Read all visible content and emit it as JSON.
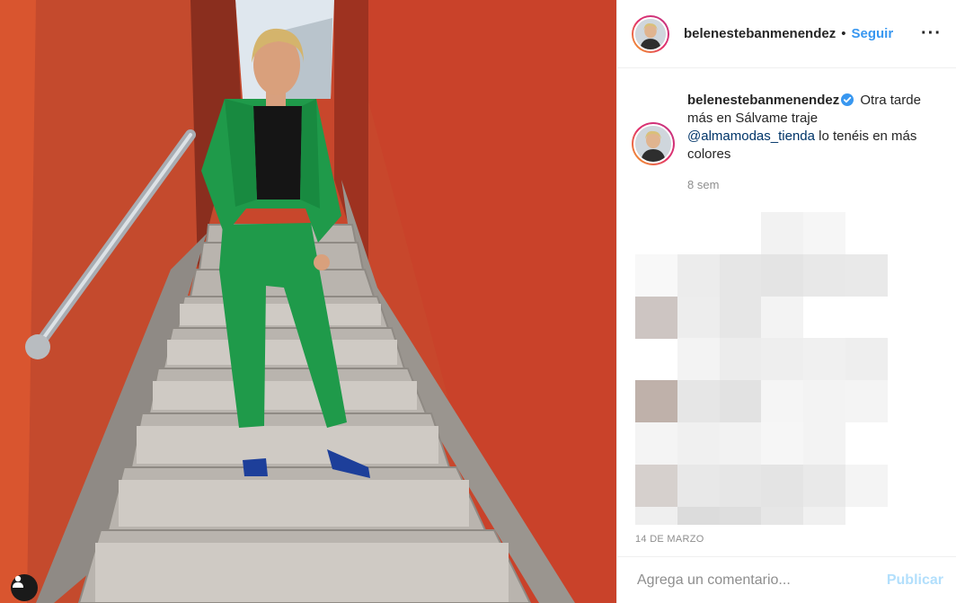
{
  "post": {
    "username": "belenestebanmenendez",
    "separator": "•",
    "follow_label": "Seguir",
    "more_label": "···"
  },
  "caption": {
    "username": "belenestebanmenendez",
    "text_1": "Otra tarde más en Sálvame traje",
    "mention": "@almamodas_tienda",
    "text_2": "lo tenéis en más colores",
    "time": "8 sem"
  },
  "date": "14 DE MARZO",
  "comment": {
    "placeholder": "Agrega un comentario...",
    "publish_label": "Publicar"
  },
  "colors": {
    "accent": "#3897f0",
    "publish_disabled": "#b2dffc",
    "mention": "#003569",
    "wall": "#c8472c",
    "suit": "#1f9a4a"
  },
  "icons": {
    "verified": "verified-badge-icon",
    "more": "more-options-icon",
    "tag": "user-tag-icon"
  }
}
